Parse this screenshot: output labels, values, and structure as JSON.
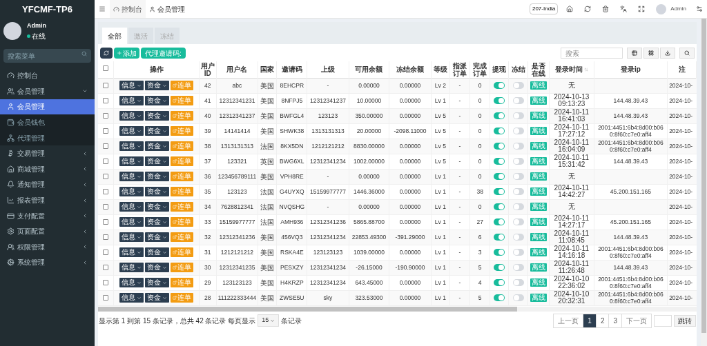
{
  "brand": "YFCMF-TP6",
  "user": {
    "name": "Admin",
    "status": "在线"
  },
  "menu_search": {
    "placeholder": "搜索菜单"
  },
  "menu": [
    {
      "label": "控制台",
      "expanded": false
    },
    {
      "label": "会员管理",
      "expanded": true,
      "children": [
        {
          "label": "会员管理",
          "selected": true
        },
        {
          "label": "会员钱包",
          "selected": false
        },
        {
          "label": "代理管理",
          "selected": false
        }
      ]
    },
    {
      "label": "交易管理",
      "expanded": false
    },
    {
      "label": "商城管理",
      "expanded": false
    },
    {
      "label": "通知管理",
      "expanded": false
    },
    {
      "label": "报表管理",
      "expanded": false
    },
    {
      "label": "支付配置",
      "expanded": false
    },
    {
      "label": "页面配置",
      "expanded": false
    },
    {
      "label": "权限管理",
      "expanded": false
    },
    {
      "label": "系统管理",
      "expanded": false
    }
  ],
  "breadcrumbs": [
    {
      "label": "控制台",
      "selected": false
    },
    {
      "label": "会员管理",
      "selected": true
    }
  ],
  "top_bar": {
    "badge": "207-India",
    "user": "Admin"
  },
  "tabs": [
    {
      "label": "全部",
      "selected": true
    },
    {
      "label": "激活",
      "selected": false
    },
    {
      "label": "冻结",
      "selected": false
    }
  ],
  "toolbar": {
    "add": "添加",
    "invite": "代理邀请码:",
    "search": {
      "placeholder": "搜索"
    }
  },
  "table": {
    "select_all_checked": false,
    "columns": [
      "操作",
      "用户ID",
      "用户名",
      "国家",
      "邀请码",
      "上级",
      "可用余额",
      "冻结余额",
      "等级",
      "指派订单",
      "完成订单",
      "提现",
      "冻结",
      "是否在线",
      "登录时间",
      "登录ip",
      "注"
    ],
    "rows": [
      {
        "checked": false,
        "actions": [
          "信息",
          "资金",
          "连单"
        ],
        "id": "42",
        "username": "abc",
        "country": "美国",
        "code": "8EHCPR",
        "parent": "-",
        "balance": "0.00000",
        "frozen": "0.00000",
        "level": "Lv 2",
        "assigned": "-",
        "completed": "0",
        "withdraw": true,
        "freeze": false,
        "online": "离线",
        "login_time": "无",
        "reg": "2024-10-"
      },
      {
        "checked": false,
        "actions": [
          "信息",
          "资金",
          "连单"
        ],
        "id": "41",
        "username": "12312341231",
        "country": "美国",
        "code": "8NFPJ5",
        "parent": "12312341237",
        "balance": "10.00000",
        "frozen": "0.00000",
        "level": "Lv 1",
        "assigned": "-",
        "completed": "0",
        "withdraw": true,
        "freeze": false,
        "online": "离线",
        "login_time": "2024-10-13 09:13:23",
        "login_ip": "144.48.39.43",
        "reg": "2024-10-"
      },
      {
        "checked": false,
        "actions": [
          "信息",
          "资金",
          "连单"
        ],
        "id": "40",
        "username": "12312341237",
        "country": "美国",
        "code": "BWFGL4",
        "parent": "123123",
        "balance": "350.00000",
        "frozen": "0.00000",
        "level": "Lv 5",
        "assigned": "-",
        "completed": "0",
        "withdraw": true,
        "freeze": false,
        "online": "离线",
        "login_time": "2024-10-11 16:41:03",
        "login_ip": "144.48.39.43",
        "reg": "2024-10-"
      },
      {
        "checked": false,
        "actions": [
          "信息",
          "资金",
          "连单"
        ],
        "id": "39",
        "username": "14141414",
        "country": "美国",
        "code": "SHWK38",
        "parent": "1313131313",
        "balance": "20.00000",
        "frozen": "-2098.11000",
        "level": "Lv 5",
        "assigned": "-",
        "completed": "0",
        "withdraw": true,
        "freeze": false,
        "online": "离线",
        "login_time": "2024-10-11 17:27:12",
        "login_ip": "2001:4451:6b4:8d00:b060:8f60:c7e0:aff4",
        "reg": "2024-10-"
      },
      {
        "checked": false,
        "actions": [
          "信息",
          "资金",
          "连单"
        ],
        "id": "38",
        "username": "1313131313",
        "country": "法国",
        "code": "8KX5DN",
        "parent": "1212121212",
        "balance": "8830.00000",
        "frozen": "0.00000",
        "level": "Lv 5",
        "assigned": "-",
        "completed": "0",
        "withdraw": true,
        "freeze": false,
        "online": "离线",
        "login_time": "2024-10-11 16:04:09",
        "login_ip": "2001:4451:6b4:8d00:b060:8f60:c7e0:aff4",
        "reg": "2024-10-"
      },
      {
        "checked": false,
        "actions": [
          "信息",
          "资金",
          "连单"
        ],
        "id": "37",
        "username": "123321",
        "country": "英国",
        "code": "BWG6XL",
        "parent": "12312341234",
        "balance": "1002.00000",
        "frozen": "0.00000",
        "level": "Lv 5",
        "assigned": "-",
        "completed": "0",
        "withdraw": true,
        "freeze": false,
        "online": "离线",
        "login_time": "2024-10-11 15:31:42",
        "login_ip": "144.48.39.43",
        "reg": "2024-10-"
      },
      {
        "checked": false,
        "actions": [
          "信息",
          "资金",
          "连单"
        ],
        "id": "36",
        "username": "123456789111",
        "country": "美国",
        "code": "VPH8RE",
        "parent": "-",
        "balance": "0.00000",
        "frozen": "0.00000",
        "level": "Lv 1",
        "assigned": "-",
        "completed": "0",
        "withdraw": true,
        "freeze": false,
        "online": "离线",
        "login_time": "无",
        "reg": "2024-10-"
      },
      {
        "checked": false,
        "actions": [
          "信息",
          "资金",
          "连单"
        ],
        "id": "35",
        "username": "123123",
        "country": "法国",
        "code": "G4UYXQ",
        "parent": "15159977777",
        "balance": "1446.36000",
        "frozen": "0.00000",
        "level": "Lv 1",
        "assigned": "-",
        "completed": "38",
        "withdraw": true,
        "freeze": false,
        "online": "离线",
        "login_time": "2024-10-11 14:42:27",
        "login_ip": "45.200.151.165",
        "reg": "2024-10-"
      },
      {
        "checked": false,
        "actions": [
          "信息",
          "资金",
          "连单"
        ],
        "id": "34",
        "username": "7628812341",
        "country": "法国",
        "code": "NVQSHG",
        "parent": "-",
        "balance": "0.00000",
        "frozen": "0.00000",
        "level": "Lv 1",
        "assigned": "-",
        "completed": "0",
        "withdraw": true,
        "freeze": false,
        "online": "离线",
        "login_time": "无",
        "reg": "2024-10-"
      },
      {
        "checked": false,
        "actions": [
          "信息",
          "资金",
          "连单"
        ],
        "id": "33",
        "username": "15159977777",
        "country": "法国",
        "code": "AMH936",
        "parent": "12312341236",
        "balance": "5865.88700",
        "frozen": "0.00000",
        "level": "Lv 1",
        "assigned": "-",
        "completed": "27",
        "withdraw": true,
        "freeze": false,
        "online": "离线",
        "login_time": "2024-10-11 14:27:17",
        "login_ip": "45.200.151.165",
        "reg": "2024-10-"
      },
      {
        "checked": false,
        "actions": [
          "信息",
          "资金",
          "连单"
        ],
        "id": "32",
        "username": "12312341236",
        "country": "美国",
        "code": "456VQ3",
        "parent": "12312341234",
        "balance": "22853.49300",
        "frozen": "-391.29000",
        "level": "Lv 1",
        "assigned": "-",
        "completed": "6",
        "withdraw": true,
        "freeze": false,
        "online": "离线",
        "login_time": "2024-10-11 11:08:45",
        "login_ip": "144.48.39.43",
        "reg": "2024-10-"
      },
      {
        "checked": false,
        "actions": [
          "信息",
          "资金",
          "连单"
        ],
        "id": "31",
        "username": "1212121212",
        "country": "美国",
        "code": "RSKA4E",
        "parent": "123123123",
        "balance": "1039.00000",
        "frozen": "0.00000",
        "level": "Lv 1",
        "assigned": "-",
        "completed": "3",
        "withdraw": true,
        "freeze": false,
        "online": "离线",
        "login_time": "2024-10-11 14:16:18",
        "login_ip": "2001:4451:6b4:8d00:b060:8f60:c7e0:aff4",
        "reg": "2024-10-"
      },
      {
        "checked": false,
        "actions": [
          "信息",
          "资金",
          "连单"
        ],
        "id": "30",
        "username": "12312341235",
        "country": "美国",
        "code": "PESXZY",
        "parent": "12312341234",
        "balance": "-26.15000",
        "frozen": "-190.90000",
        "level": "Lv 1",
        "assigned": "-",
        "completed": "5",
        "withdraw": true,
        "freeze": false,
        "online": "离线",
        "login_time": "2024-10-11 11:26:48",
        "login_ip": "144.48.39.43",
        "reg": "2024-10-"
      },
      {
        "checked": false,
        "actions": [
          "信息",
          "资金",
          "连单"
        ],
        "id": "29",
        "username": "123123123",
        "country": "美国",
        "code": "H4KRZP",
        "parent": "12312341234",
        "balance": "643.45000",
        "frozen": "0.00000",
        "level": "Lv 1",
        "assigned": "-",
        "completed": "4",
        "withdraw": true,
        "freeze": false,
        "online": "离线",
        "login_time": "2024-10-10 22:36:02",
        "login_ip": "2001:4451:6b4:8d00:b060:8f60:c7e0:aff4",
        "reg": "2024-10-"
      },
      {
        "checked": false,
        "actions": [
          "信息",
          "资金",
          "连单"
        ],
        "id": "28",
        "username": "111222333444",
        "country": "美国",
        "code": "ZWSE5U",
        "parent": "sky",
        "balance": "323.53000",
        "frozen": "0.00000",
        "level": "Lv 1",
        "assigned": "-",
        "completed": "5",
        "withdraw": true,
        "freeze": false,
        "online": "离线",
        "login_time": "2024-10-10 20:32:31",
        "login_ip": "2001:4451:6b4:8d00:b060:8f60:c7e0:aff4",
        "reg": "2024-10-"
      }
    ]
  },
  "footer": {
    "summary": "显示第 1 到第 15 条记录，总共 42 条记录 每页显示",
    "page_size": "15",
    "suffix": "条记录"
  },
  "pagination": {
    "prev": "上一页",
    "pages": [
      {
        "label": "1",
        "selected": true
      },
      {
        "label": "2",
        "selected": false
      },
      {
        "label": "3",
        "selected": false
      }
    ],
    "next": "下一页",
    "go": "跳转"
  }
}
